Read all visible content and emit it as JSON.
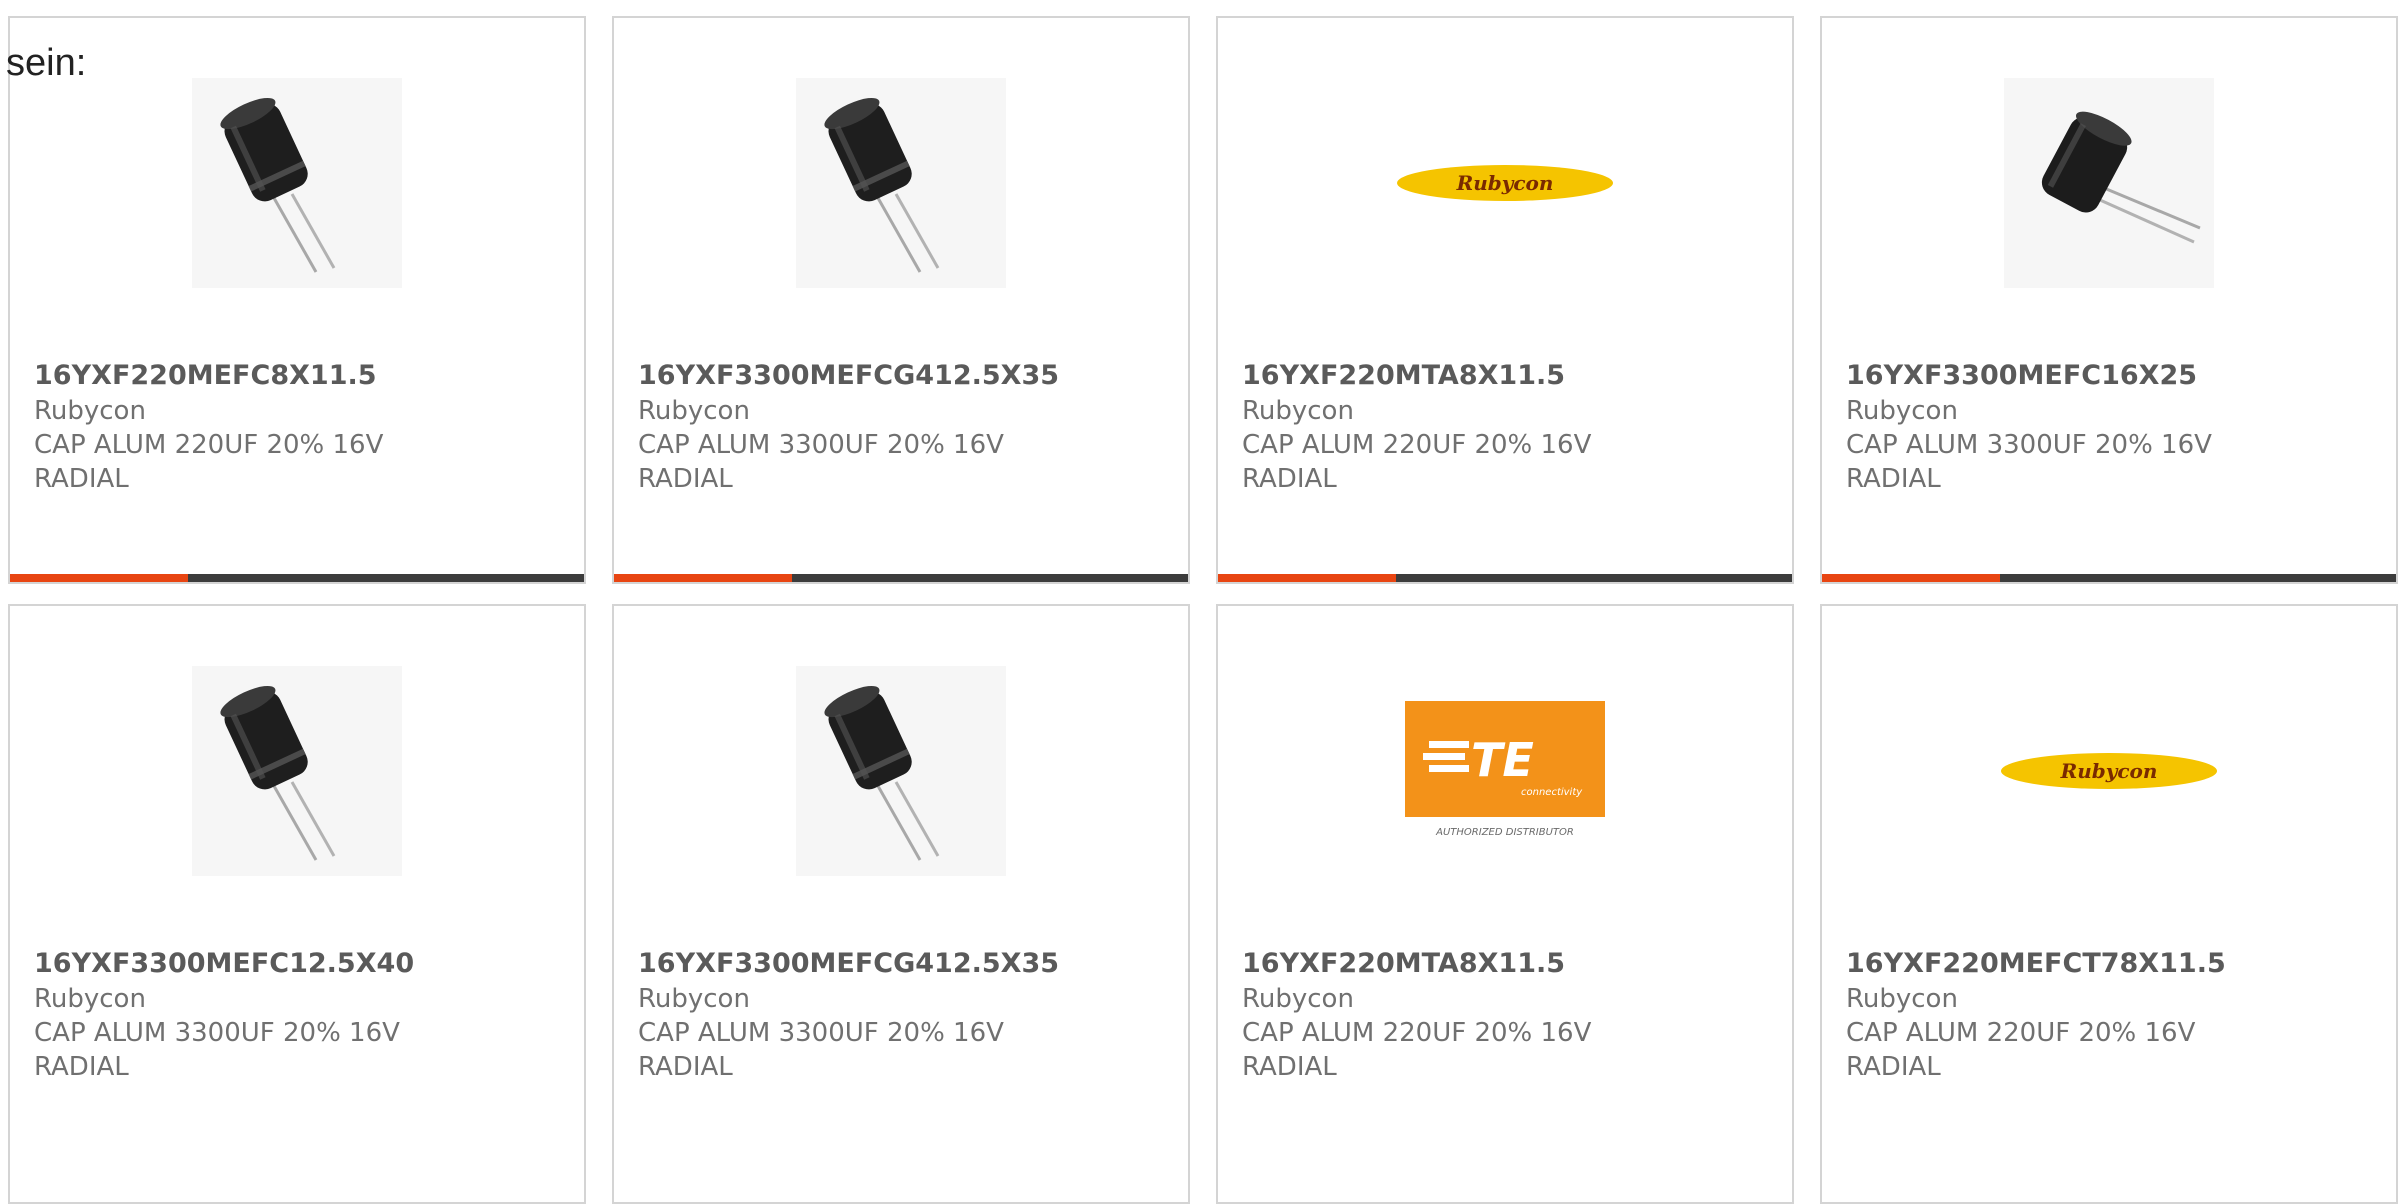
{
  "intro_text": "sein:",
  "colors": {
    "accent": "#e84512",
    "track": "#3c3c3c",
    "border": "#d4d4d4",
    "text": "#707070",
    "rubycon_yellow": "#f5c400",
    "rubycon_text": "#7a2a00",
    "te_orange": "#f39219"
  },
  "products": [
    {
      "image": "capacitor-photo",
      "part_number": "16YXF220MEFC8X11.5",
      "manufacturer": "Rubycon",
      "description": "CAP ALUM 220UF 20% 16V RADIAL",
      "progress": 0.31
    },
    {
      "image": "capacitor-photo",
      "part_number": "16YXF3300MEFCG412.5X35",
      "manufacturer": "Rubycon",
      "description": "CAP ALUM 3300UF 20% 16V RADIAL",
      "progress": 0.31
    },
    {
      "image": "rubycon-logo",
      "logo_text": "Rubycon",
      "part_number": "16YXF220MTA8X11.5",
      "manufacturer": "Rubycon",
      "description": "CAP ALUM 220UF 20% 16V RADIAL",
      "progress": 0.31
    },
    {
      "image": "capacitor-photo-angled",
      "part_number": "16YXF3300MEFC16X25",
      "manufacturer": "Rubycon",
      "description": "CAP ALUM 3300UF 20% 16V RADIAL",
      "progress": 0.31
    },
    {
      "image": "capacitor-photo",
      "part_number": "16YXF3300MEFC12.5X40",
      "manufacturer": "Rubycon",
      "description": "CAP ALUM 3300UF 20% 16V RADIAL",
      "progress": null
    },
    {
      "image": "capacitor-photo",
      "part_number": "16YXF3300MEFCG412.5X35",
      "manufacturer": "Rubycon",
      "description": "CAP ALUM 3300UF 20% 16V RADIAL",
      "progress": null
    },
    {
      "image": "te-connectivity-logo",
      "logo_text": "TE",
      "logo_subtext": "connectivity",
      "logo_caption": "AUTHORIZED DISTRIBUTOR",
      "part_number": "16YXF220MTA8X11.5",
      "manufacturer": "Rubycon",
      "description": "CAP ALUM 220UF 20% 16V RADIAL",
      "progress": null
    },
    {
      "image": "rubycon-logo",
      "logo_text": "Rubycon",
      "part_number": "16YXF220MEFCT78X11.5",
      "manufacturer": "Rubycon",
      "description": "CAP ALUM 220UF 20% 16V RADIAL",
      "progress": null
    }
  ]
}
